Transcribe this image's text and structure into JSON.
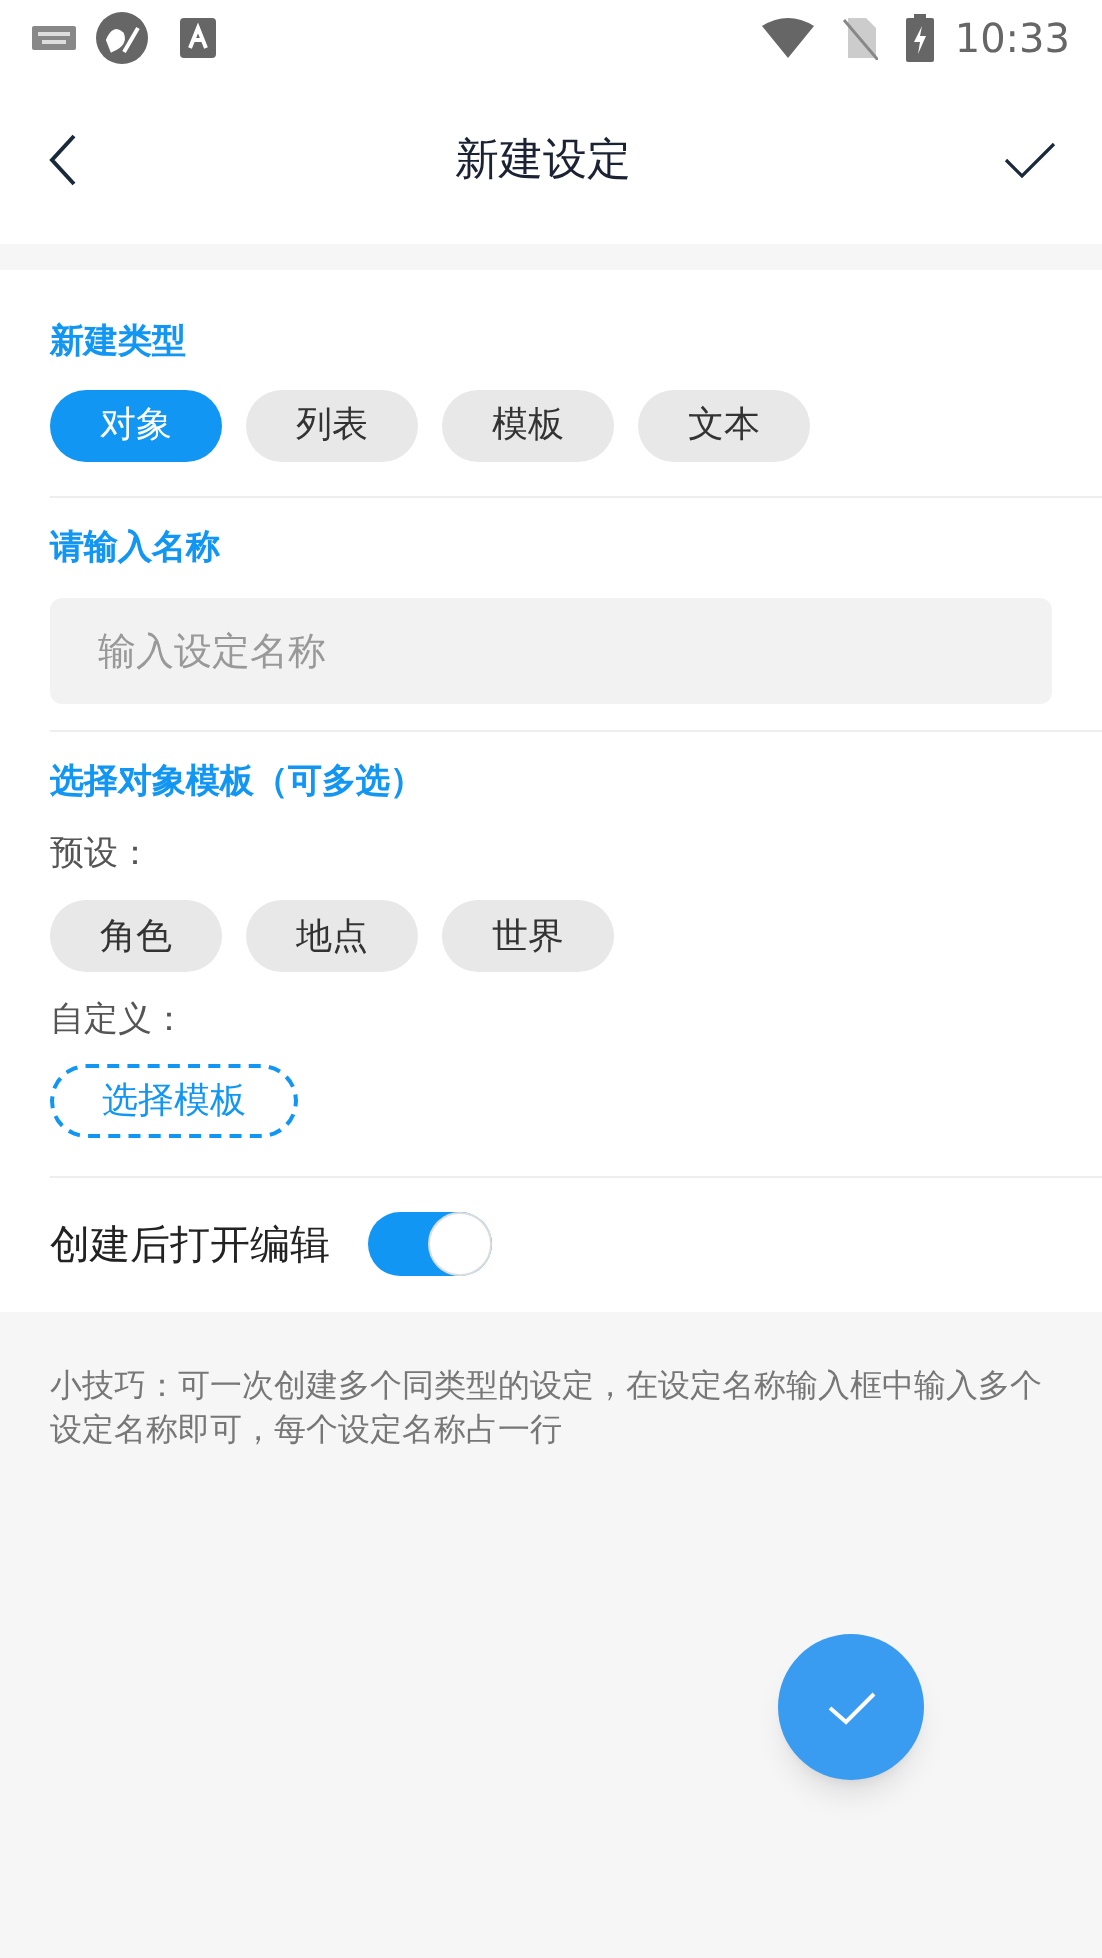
{
  "status_bar": {
    "time": "10:33"
  },
  "header": {
    "title": "新建设定"
  },
  "type_section": {
    "label": "新建类型",
    "options": [
      {
        "label": "对象",
        "selected": true
      },
      {
        "label": "列表",
        "selected": false
      },
      {
        "label": "模板",
        "selected": false
      },
      {
        "label": "文本",
        "selected": false
      }
    ]
  },
  "name_section": {
    "label": "请输入名称",
    "placeholder": "输入设定名称"
  },
  "template_section": {
    "label": "选择对象模板（可多选）",
    "preset_label": "预设：",
    "presets": [
      {
        "label": "角色",
        "selected": false
      },
      {
        "label": "地点",
        "selected": false
      },
      {
        "label": "世界",
        "selected": false
      }
    ],
    "custom_label": "自定义：",
    "choose_button": "选择模板"
  },
  "open_editor": {
    "label": "创建后打开编辑",
    "on": true
  },
  "tip": "小技巧：可一次创建多个同类型的设定，在设定名称输入框中输入多个设定名称即可，每个设定名称占一行"
}
